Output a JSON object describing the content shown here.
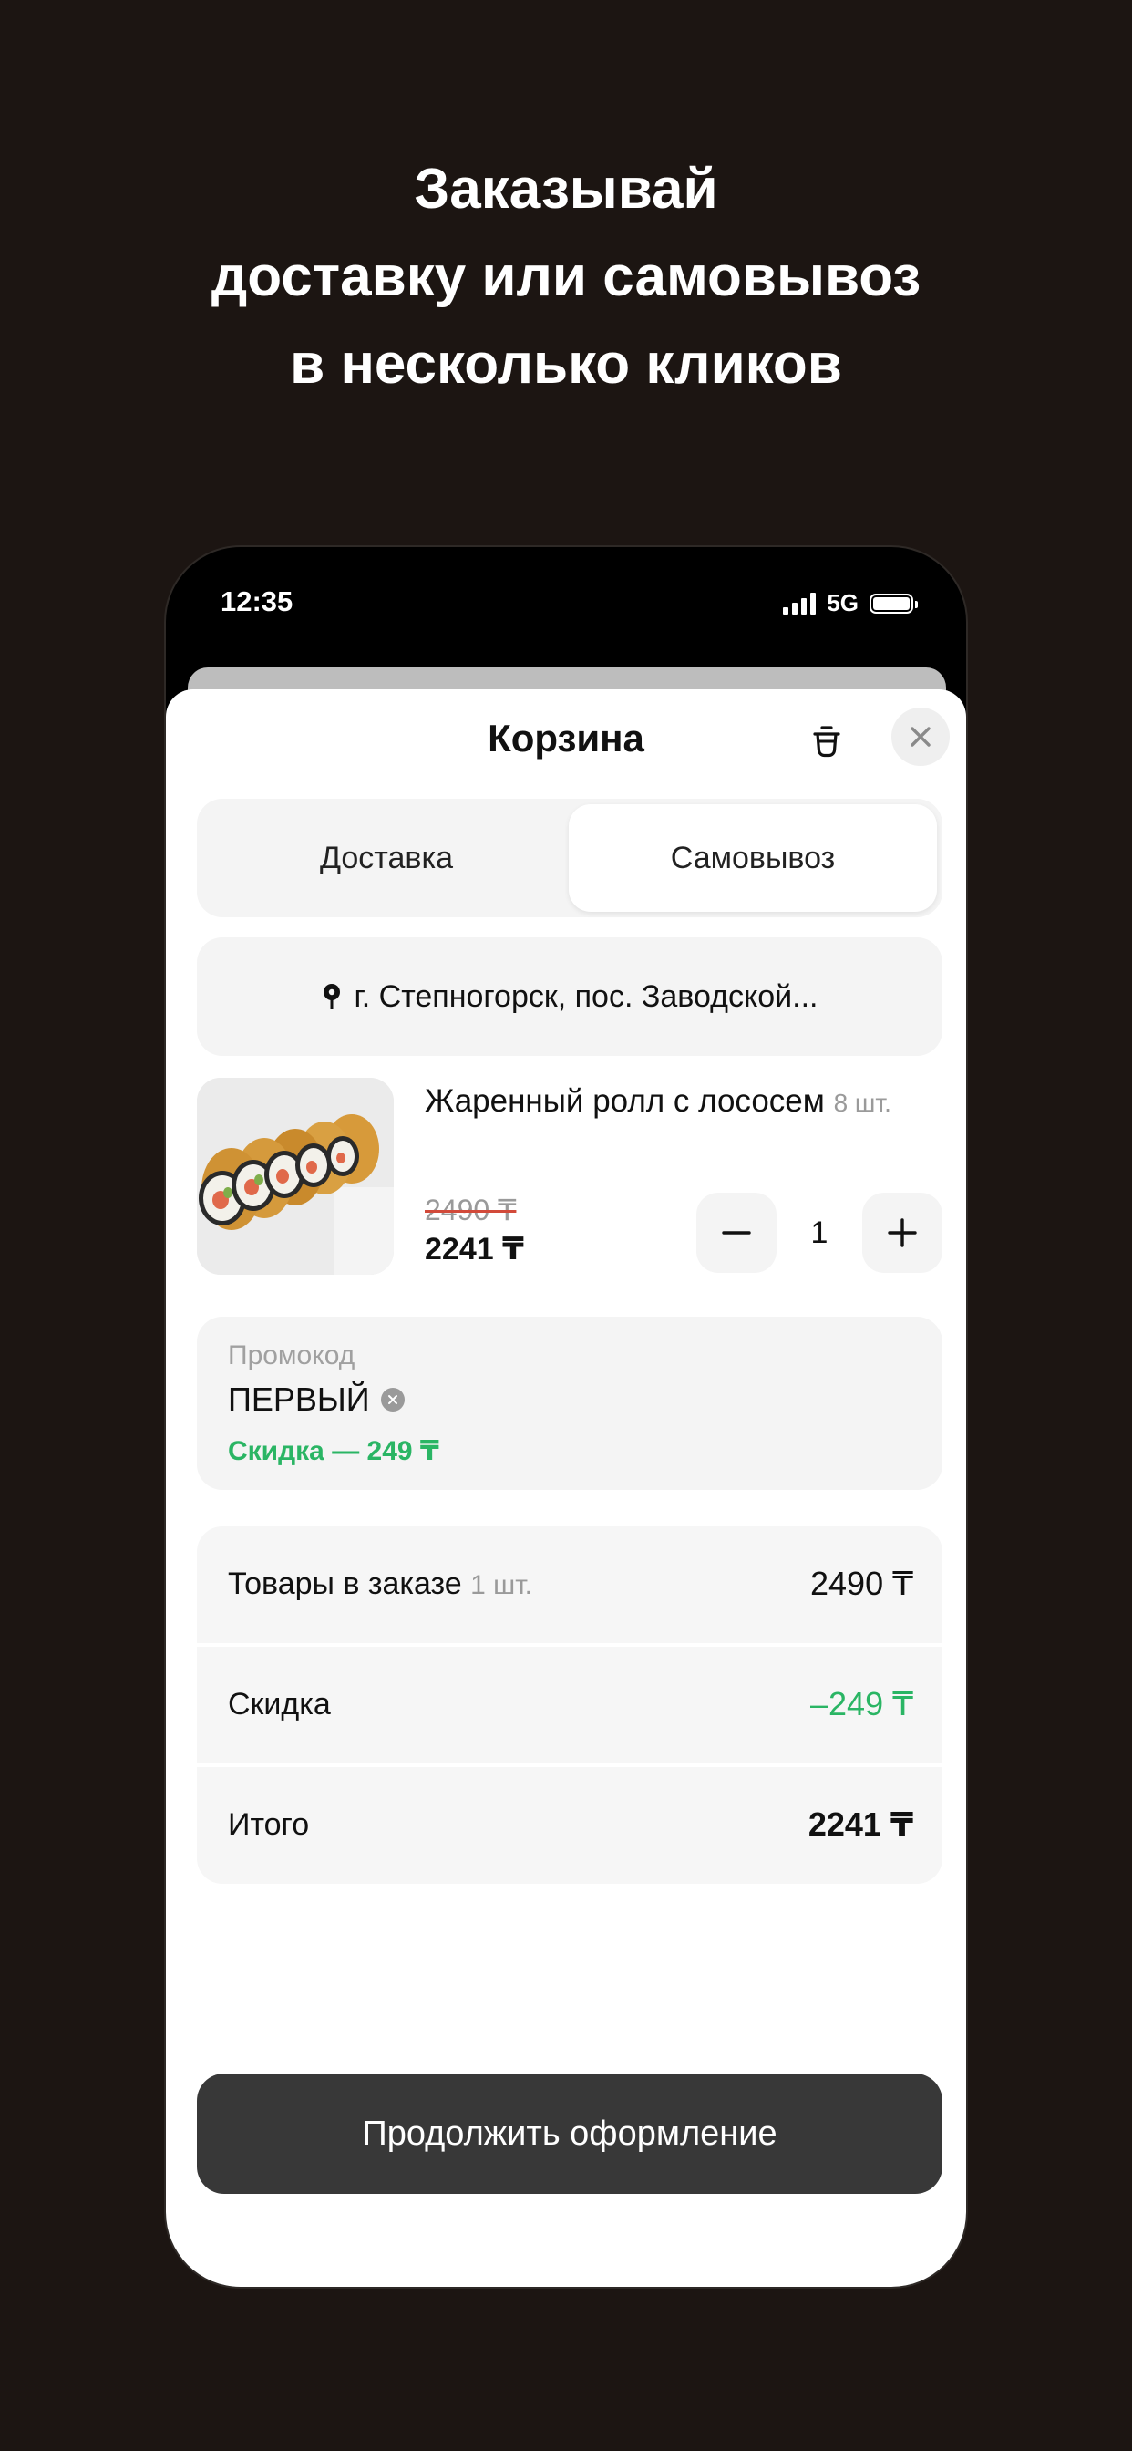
{
  "headline": {
    "line1": "Заказывай",
    "line2": "доставку или самовывоз",
    "line3": "в несколько кликов"
  },
  "status_bar": {
    "time": "12:35",
    "network": "5G"
  },
  "cart": {
    "title": "Корзина",
    "tabs": [
      {
        "label": "Доставка",
        "selected": false
      },
      {
        "label": "Самовывоз",
        "selected": true
      }
    ],
    "address": "г. Степногорск, пос. Заводской...",
    "item": {
      "name": "Жаренный ролл с лососем",
      "pieces": "8 шт.",
      "old_price": "2490 ₸",
      "new_price": "2241 ₸",
      "quantity": "1"
    },
    "promo": {
      "label": "Промокод",
      "code": "ПЕРВЫЙ",
      "discount": "Скидка — 249 ₸"
    },
    "summary": {
      "items_label": "Товары в заказе",
      "items_count": "1 шт.",
      "items_value": "2490 ₸",
      "discount_label": "Скидка",
      "discount_value": "–249 ₸",
      "total_label": "Итого",
      "total_value": "2241 ₸"
    },
    "cta_label": "Продолжить оформление"
  },
  "colors": {
    "background": "#1c1512",
    "accent_green": "#2ab564",
    "cta": "#383838"
  }
}
